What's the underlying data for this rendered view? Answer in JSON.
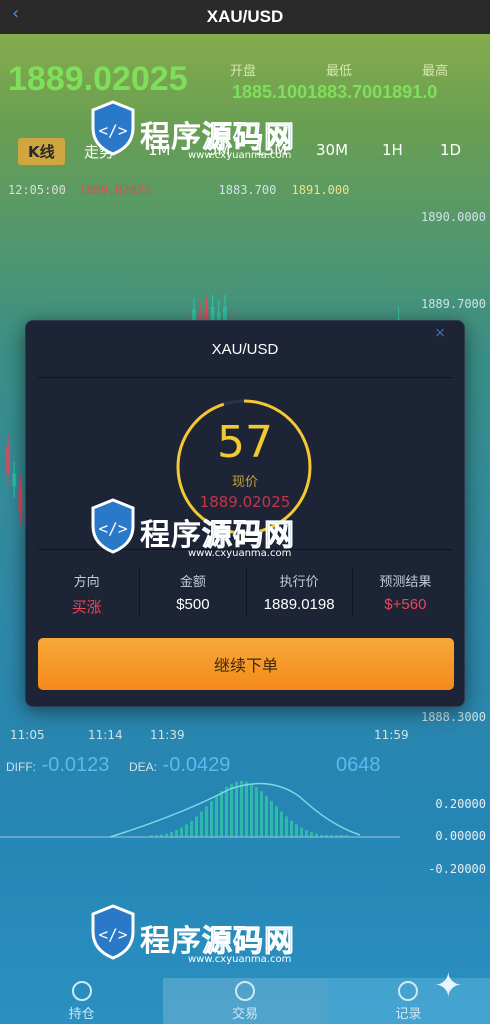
{
  "header": {
    "back_icon": "back-chevron-icon",
    "title": "XAU/USD"
  },
  "quote": {
    "last_price": "1889.02025",
    "labels": {
      "open": "开盘",
      "low": "最低",
      "high": "最高"
    },
    "values_text": "1885.1001883.7001891.0"
  },
  "tabs": [
    {
      "label": "K线",
      "active": true
    },
    {
      "label": "走势",
      "active": false
    },
    {
      "label": "1M",
      "active": false
    },
    {
      "label": "5M",
      "active": false
    },
    {
      "label": "15M",
      "active": false
    },
    {
      "label": "30M",
      "active": false
    },
    {
      "label": "1H",
      "active": false
    },
    {
      "label": "1D",
      "active": false
    }
  ],
  "ohlc_row": {
    "time": "12:05:00",
    "open": "1889.02025",
    "low": "1883.700",
    "high": "1891.000"
  },
  "price_axis": [
    "1890.0000",
    "1889.7000",
    "1888.3000"
  ],
  "time_axis": [
    "11:05",
    "11:14",
    "11:39",
    "11:59"
  ],
  "diff_row": {
    "label": "DIFF:",
    "diff": "-0.0123",
    "dea_label": "DEA:",
    "dea": "-0.0429",
    "macd": "0648"
  },
  "macd_axis": [
    "0.20000",
    "0.00000",
    "-0.20000"
  ],
  "bottom_nav": [
    {
      "label": "持仓",
      "icon": "portfolio-icon"
    },
    {
      "label": "交易",
      "icon": "trade-icon"
    },
    {
      "label": "记录",
      "icon": "record-icon"
    }
  ],
  "watermark": {
    "text_white": "程序",
    "text_blue": "源码网",
    "url": "www.cxyuanma.com"
  },
  "modal": {
    "title": "XAU/USD",
    "close_icon": "close-icon",
    "countdown": "57",
    "current_label": "现价",
    "current_price": "1889.02025",
    "countdown_progress": 0.95,
    "cells": [
      {
        "key": "方向",
        "value": "买涨"
      },
      {
        "key": "金额",
        "value": "$500"
      },
      {
        "key": "执行价",
        "value": "1889.0198"
      },
      {
        "key": "预测结果",
        "value": "$+560"
      }
    ],
    "continue_label": "继续下单"
  },
  "colors": {
    "up": "#e8475b",
    "down": "#2fc7a8",
    "accent_gold": "#f2c833",
    "button_orange": "#f48a1a",
    "price_green": "#7ee05a"
  }
}
